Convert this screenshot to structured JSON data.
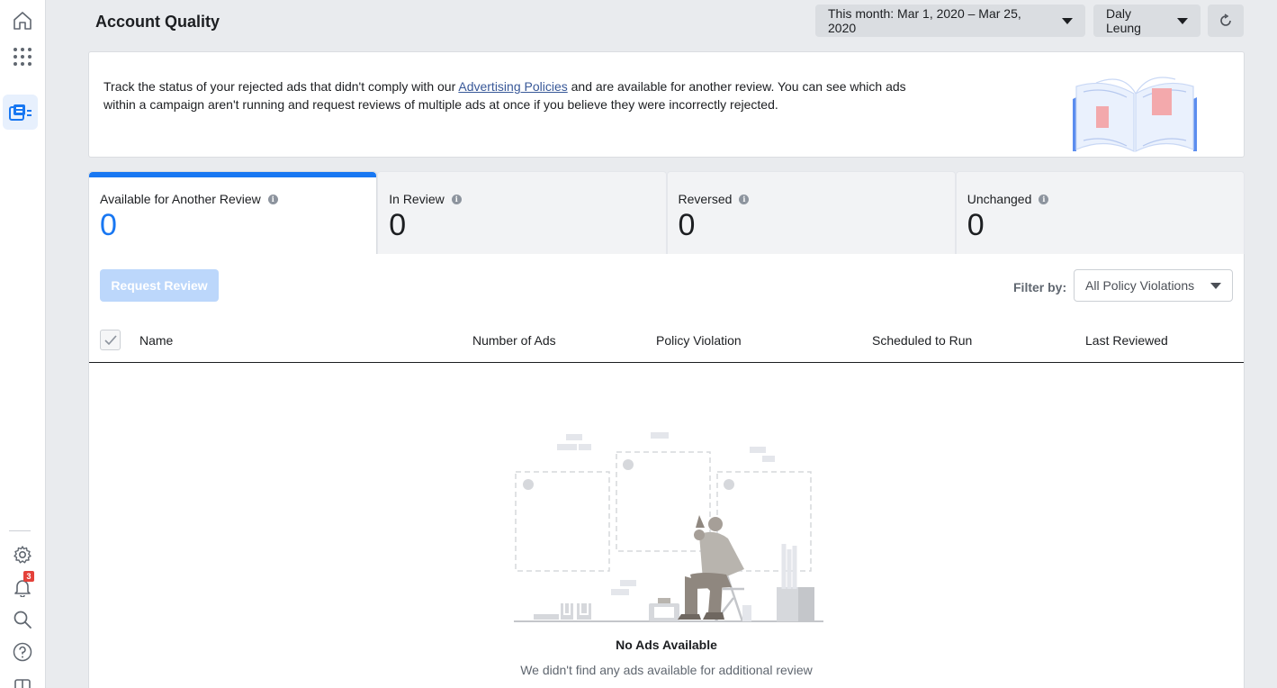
{
  "header": {
    "title": "Account Quality",
    "date_range": "This month: Mar 1, 2020 – Mar 25, 2020",
    "account": "Daly Leung"
  },
  "sidebar": {
    "notification_count": "3"
  },
  "info": {
    "text_before": "Track the status of your rejected ads that didn't comply with our ",
    "link": "Advertising Policies",
    "text_after": " and are available for another review. You can see which ads within a campaign aren't running and request reviews of multiple ads at once if you believe they were incorrectly rejected."
  },
  "tabs": [
    {
      "label": "Available for Another Review",
      "count": "0"
    },
    {
      "label": "In Review",
      "count": "0"
    },
    {
      "label": "Reversed",
      "count": "0"
    },
    {
      "label": "Unchanged",
      "count": "0"
    }
  ],
  "toolbar": {
    "request_review": "Request Review",
    "filter_label": "Filter by:",
    "filter_value": "All Policy Violations"
  },
  "table": {
    "columns": [
      "Name",
      "Number of Ads",
      "Policy Violation",
      "Scheduled to Run",
      "Last Reviewed"
    ]
  },
  "empty_state": {
    "title": "No Ads Available",
    "subtitle": "We didn't find any ads available for additional review"
  },
  "colors": {
    "accent": "#1877f2",
    "badge": "#e4413a"
  }
}
